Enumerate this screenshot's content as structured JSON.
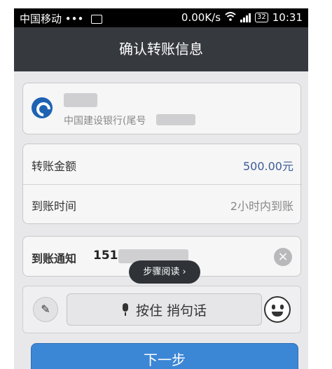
{
  "status_bar": {
    "carrier": "中国移动 •••",
    "net_speed": "0.00K/s",
    "battery": "32",
    "time": "10:31"
  },
  "header": {
    "title": "确认转账信息"
  },
  "bank_card": {
    "bank_subtitle": "中国建设银行(尾号"
  },
  "details": {
    "amount_label": "转账金额",
    "amount_value": "500.00元",
    "arrival_label": "到账时间",
    "arrival_value": "2小时内到账"
  },
  "notify": {
    "label": "到账通知",
    "phone_prefix": "151"
  },
  "toast": {
    "text": "步骤阅读 ›"
  },
  "input_bar": {
    "hold_label": "按住 捎句话"
  },
  "next_button": {
    "label": "下一步"
  },
  "colors": {
    "navbar": "#36393e",
    "amount_value": "#3d5c99",
    "primary_button": "#3c86d6"
  },
  "icons": [
    "image-icon",
    "wifi-icon",
    "signal-icon",
    "battery-icon",
    "bank-logo-icon",
    "clear-icon",
    "keyboard-icon",
    "microphone-icon",
    "emoji-icon"
  ]
}
